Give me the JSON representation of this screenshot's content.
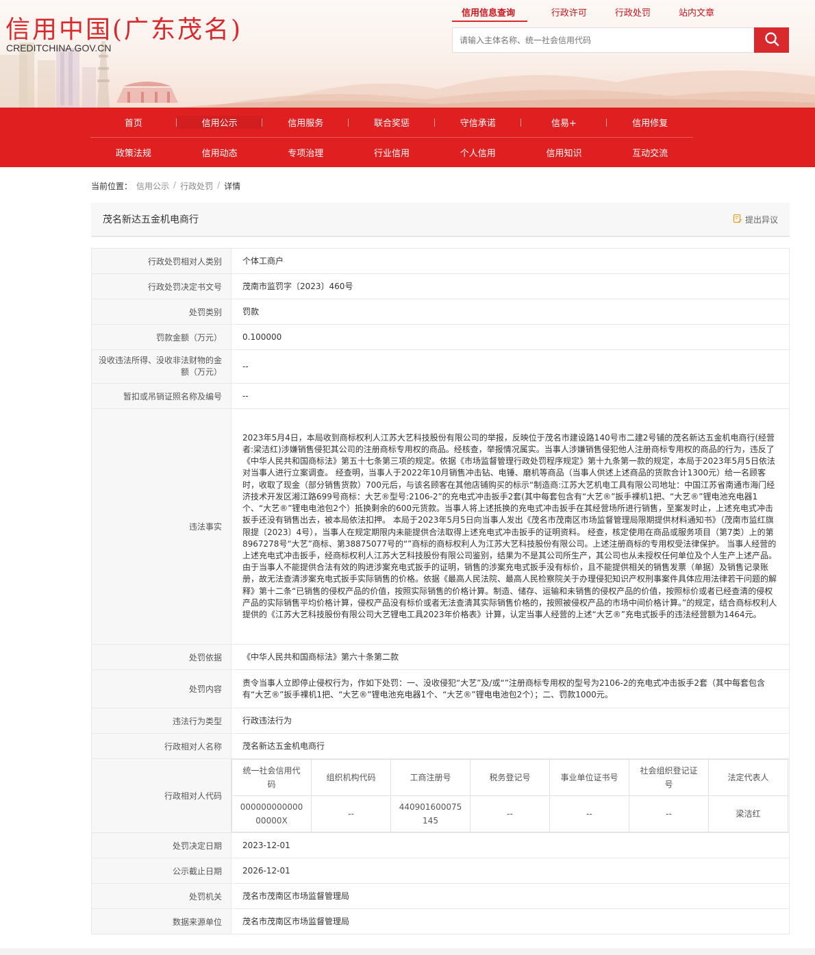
{
  "header": {
    "logo_cn": "信用中国(广东茂名)",
    "logo_en": "CREDITCHINA.GOV.CN",
    "top_tabs": [
      "信用信息查询",
      "行政许可",
      "行政处罚",
      "站内文章"
    ],
    "search_placeholder": "请输入主体名称、统一社会信用代码",
    "search_icon": "search-icon"
  },
  "nav": {
    "row1": [
      "首页",
      "信用公示",
      "信用服务",
      "联合奖惩",
      "守信承诺",
      "信易+",
      "信用修复"
    ],
    "row2": [
      "政策法规",
      "信用动态",
      "专项治理",
      "行业信用",
      "个人信用",
      "信用知识",
      "互动交流"
    ]
  },
  "breadcrumb": {
    "label": "当前位置：",
    "items": [
      "信用公示",
      "行政处罚",
      "详情"
    ],
    "sep": "/"
  },
  "title": {
    "name": "茂名新达五金机电商行",
    "objection": "提出异议",
    "objection_icon": "edit-document-icon"
  },
  "detail": {
    "rows": [
      {
        "label": "行政处罚相对人类别",
        "value": "个体工商户"
      },
      {
        "label": "行政处罚决定书文号",
        "value": "茂南市监罚字〔2023〕460号"
      },
      {
        "label": "处罚类别",
        "value": "罚款"
      },
      {
        "label": "罚款金额（万元）",
        "value": "0.100000"
      },
      {
        "label": "没收违法所得、没收非法财物的金额（万元）",
        "value": "--"
      },
      {
        "label": "暂扣或吊销证照名称及编号",
        "value": "--"
      },
      {
        "label": "违法事实",
        "value": "2023年5月4日，本局收到商标权利人江苏大艺科技股份有限公司的举报，反映位于茂名市建设路140号市二建2号铺的茂名新达五金机电商行(经营者:梁洁红)涉嫌销售侵犯其公司的注册商标专用权的商品。经核查，举报情况属实。当事人涉嫌销售侵犯他人注册商标专用权的商品的行为，违反了《中华人民共和国商标法》第五十七条第三项的规定。依据《市场监督管理行政处罚程序规定》第十九条第一款的规定，本局于2023年5月5日依法对当事人进行立案调查。 经查明，当事人于2022年10月销售冲击钻、电锤、磨机等商品（当事人供述上述商品的货款合计1300元）给一名顾客时，收取了现金（部分销售货款）700元后，与该名顾客在其他店铺购买的标示“制造商:江苏大艺机电工具有限公司地址：中国江苏省南通市海门经济技术开发区湘江路699号商标：大艺®型号:2106-2”的充电式冲击扳手2套(其中每套包含有“大艺®”扳手裸机1把、“大艺®”锂电池充电器1个、“大艺®”锂电电池包2个）抵换剩余的600元货款。当事人将上述抵换的充电式冲击扳手在其经营场所进行销售，至案发时止，上述充电式冲击扳手还没有销售出去，被本局依法扣押。 本局于2023年5月5日向当事人发出《茂名市茂南区市场监督管理局限期提供材料通知书》（茂南市监红旗限提〔2023〕4号），当事人在规定期限内未能提供合法取得上述充电式冲击扳手的证明资料。 经查，核定使用在商品或服务项目（第7类）上的第8967278号“大艺”商标、第38875077号的“”商标的商标权利人为江苏大艺科技股份有限公司。上述注册商标的专用权受法律保护。 当事人经营的上述充电式冲击扳手，经商标权利人江苏大艺科技股份有限公司鉴别，结果为不是其公司所生产，其公司也从未授权任何单位及个人生产上述产品。由于当事人不能提供合法有效的购进涉案充电式扳手的证明，销售的涉案充电式扳手没有标价，且不能提供相关的销售发票（单据）及销售记录账册，故无法查清涉案充电式扳手实际销售的价格。依据《最高人民法院、最高人民检察院关于办理侵犯知识产权刑事案件具体应用法律若干问题的解释》第十二条“已销售的侵权产品的价值，按照实际销售的价格计算。制造、储存、运输和未销售的侵权产品的价值，按照标价或者已经查清的侵权产品的实际销售平均价格计算，侵权产品没有标价或者无法查清其实际销售价格的，按照被侵权产品的市场中间价格计算。”的规定，结合商标权利人提供的《江苏大艺科技股份有限公司大艺锂电工具2023年价格表》计算，认定当事人经营的上述“大艺®”充电式扳手的违法经营额为1464元。"
      },
      {
        "label": "处罚依据",
        "value": "《中华人民共和国商标法》第六十条第二款"
      },
      {
        "label": "处罚内容",
        "value": "责令当事人立即停止侵权行为，作如下处罚：一、没收侵犯“大艺”及/或“”注册商标专用权的型号为2106-2的充电式冲击扳手2套（其中每套包含有“大艺®”扳手裸机1把、“大艺®”锂电池充电器1个、“大艺®”锂电电池包2个）；二、罚款1000元。"
      },
      {
        "label": "违法行为类型",
        "value": "行政违法行为"
      },
      {
        "label": "行政相对人名称",
        "value": "茂名新达五金机电商行"
      }
    ],
    "code_label": "行政相对人代码",
    "code_headers": [
      "统一社会信用代码",
      "组织机构代码",
      "工商注册号",
      "税务登记号",
      "事业单位证书号",
      "社会组织登记证号",
      "法定代表人"
    ],
    "code_values": [
      "00000000000000000X",
      "--",
      "440901600075145",
      "--",
      "--",
      "--",
      "梁洁红"
    ],
    "tail_rows": [
      {
        "label": "处罚决定日期",
        "value": "2023-12-01"
      },
      {
        "label": "公示截止日期",
        "value": "2026-12-01"
      },
      {
        "label": "处罚机关",
        "value": "茂名市茂南区市场监督管理局"
      },
      {
        "label": "数据来源单位",
        "value": "茂名市茂南区市场监督管理局"
      }
    ]
  },
  "colors": {
    "brand_red": "#d8292d",
    "nav_red": "#e02020"
  }
}
